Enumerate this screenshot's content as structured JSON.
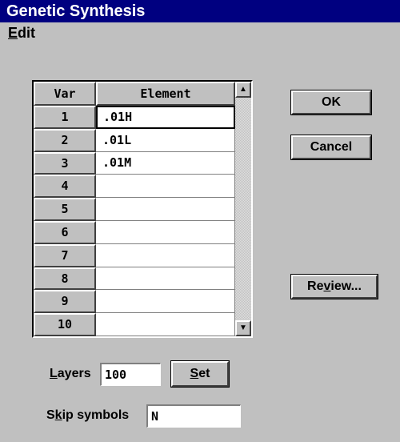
{
  "window": {
    "title": "Genetic Synthesis"
  },
  "menu": {
    "edit_prefix": "E",
    "edit_rest": "dit"
  },
  "grid": {
    "headers": {
      "var": "Var",
      "element": "Element"
    },
    "rows": [
      {
        "var": "1",
        "element": ".01H"
      },
      {
        "var": "2",
        "element": ".01L"
      },
      {
        "var": "3",
        "element": ".01M"
      },
      {
        "var": "4",
        "element": ""
      },
      {
        "var": "5",
        "element": ""
      },
      {
        "var": "6",
        "element": ""
      },
      {
        "var": "7",
        "element": ""
      },
      {
        "var": "8",
        "element": ""
      },
      {
        "var": "9",
        "element": ""
      },
      {
        "var": "10",
        "element": ""
      }
    ],
    "scroll_up_glyph": "▲",
    "scroll_down_glyph": "▼"
  },
  "buttons": {
    "ok": "OK",
    "cancel": "Cancel",
    "review_prefix": "Re",
    "review_ul": "v",
    "review_suffix": "iew..."
  },
  "layers": {
    "label_ul": "L",
    "label_rest": "ayers",
    "value": "100",
    "set_ul": "S",
    "set_rest": "et"
  },
  "skip": {
    "label_pre": "S",
    "label_ul": "k",
    "label_rest": "ip symbols",
    "value": "N"
  }
}
